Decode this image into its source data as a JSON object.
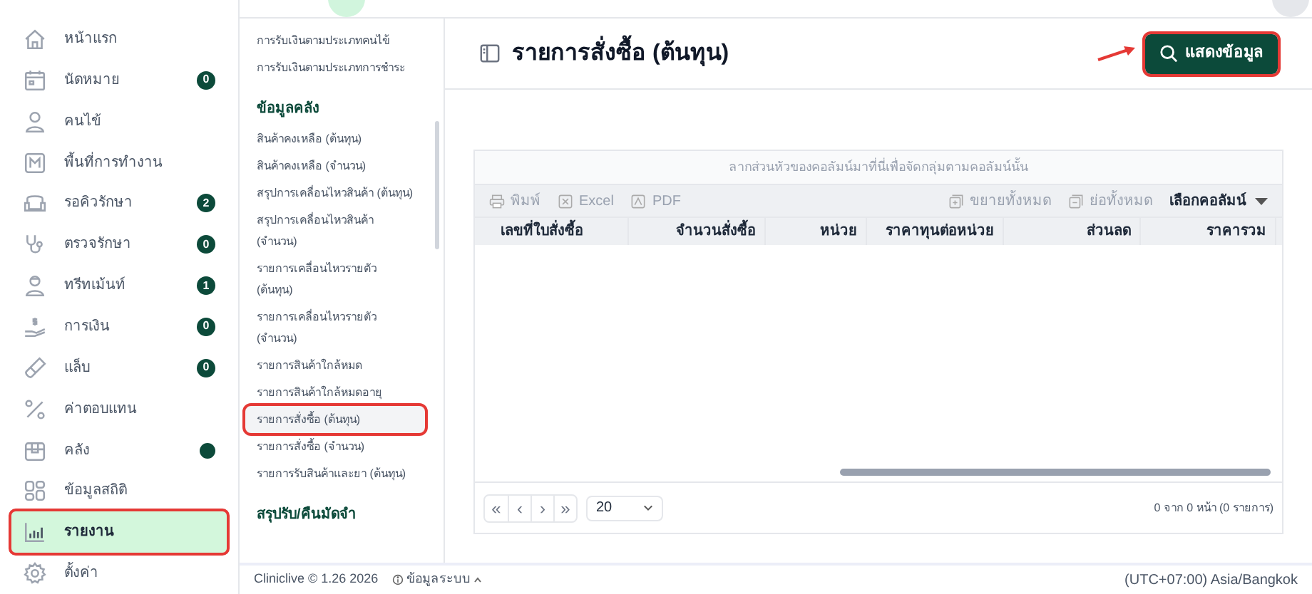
{
  "sidebar": {
    "items": [
      {
        "label": "หน้าแรก",
        "selected": false
      },
      {
        "label": "นัดหมาย",
        "badge": "0",
        "selected": false
      },
      {
        "label": "คนไข้",
        "selected": false
      },
      {
        "label": "พื้นที่การทำงาน",
        "selected": false
      },
      {
        "label": "รอคิวรักษา",
        "badge": "2",
        "selected": false
      },
      {
        "label": "ตรวจรักษา",
        "badge": "0",
        "selected": false
      },
      {
        "label": "ทรีทเม้นท์",
        "badge": "1",
        "selected": false
      },
      {
        "label": "การเงิน",
        "badge": "0",
        "selected": false
      },
      {
        "label": "แล็บ",
        "badge": "0",
        "selected": false
      },
      {
        "label": "ค่าตอบแทน",
        "selected": false
      },
      {
        "label": "คลัง",
        "dot": true,
        "selected": false
      },
      {
        "label": "ข้อมูลสถิติ",
        "selected": false
      },
      {
        "label": "รายงาน",
        "selected": true
      },
      {
        "label": "ตั้งค่า",
        "selected": false
      }
    ]
  },
  "submenu": {
    "entries": [
      {
        "kind": "item",
        "label": "การรับเงินตามประเภทคนไข้",
        "selected": false
      },
      {
        "kind": "item",
        "label": "การรับเงินตามประเภทการชำระ",
        "selected": false
      },
      {
        "kind": "heading",
        "label": "ข้อมูลคลัง"
      },
      {
        "kind": "item",
        "label": "สินค้าคงเหลือ (ต้นทุน)",
        "selected": false
      },
      {
        "kind": "item",
        "label": "สินค้าคงเหลือ (จำนวน)",
        "selected": false
      },
      {
        "kind": "item",
        "label": "สรุปการเคลื่อนไหวสินค้า (ต้นทุน)",
        "selected": false
      },
      {
        "kind": "item",
        "label": "สรุปการเคลื่อนไหวสินค้า (จำนวน)",
        "selected": false
      },
      {
        "kind": "item",
        "label": "รายการเคลื่อนไหวรายตัว (ต้นทุน)",
        "selected": false
      },
      {
        "kind": "item",
        "label": "รายการเคลื่อนไหวรายตัว (จำนวน)",
        "selected": false
      },
      {
        "kind": "item",
        "label": "รายการสินค้าใกล้หมด",
        "selected": false
      },
      {
        "kind": "item",
        "label": "รายการสินค้าใกล้หมดอายุ",
        "selected": false
      },
      {
        "kind": "item",
        "label": "รายการสั่งซื้อ (ต้นทุน)",
        "selected": true
      },
      {
        "kind": "item",
        "label": "รายการสั่งซื้อ (จำนวน)",
        "selected": false
      },
      {
        "kind": "item",
        "label": "รายการรับสินค้าและยา (ต้นทุน)",
        "selected": false
      },
      {
        "kind": "heading",
        "label": "สรุปรับ/คืนมัดจำ"
      }
    ]
  },
  "page": {
    "title": "รายการสั่งซื้อ (ต้นทุน)",
    "show_button": {
      "label": "แสดงข้อมูล",
      "highlighted": true
    }
  },
  "grid": {
    "group_panel": "ลากส่วนหัวของคอลัมน์มาที่นี่เพื่อจัดกลุ่มตามคอลัมน์นั้น",
    "toolbar_left": [
      "พิมพ์",
      "Excel",
      "PDF"
    ],
    "toolbar_right": [
      "ขยายทั้งหมด",
      "ย่อทั้งหมด"
    ],
    "column_chooser": "เลือกคอลัมน์",
    "columns": [
      "เลขที่ใบสั่งซื้อ",
      "จำนวนสั่งซื้อ",
      "หน่วย",
      "ราคาทุนต่อหน่วย",
      "ส่วนลด",
      "ราคารวม"
    ],
    "page_size": "20",
    "pager_buttons": [
      "«",
      "‹",
      "›",
      "»"
    ],
    "summary": "0 จาก 0 หน้า (0 รายการ)"
  },
  "footer": {
    "version": "Cliniclive © 1.26 2026",
    "system_info": "ข้อมูลระบบ",
    "timezone": "(UTC+07:00) Asia/Bangkok"
  }
}
